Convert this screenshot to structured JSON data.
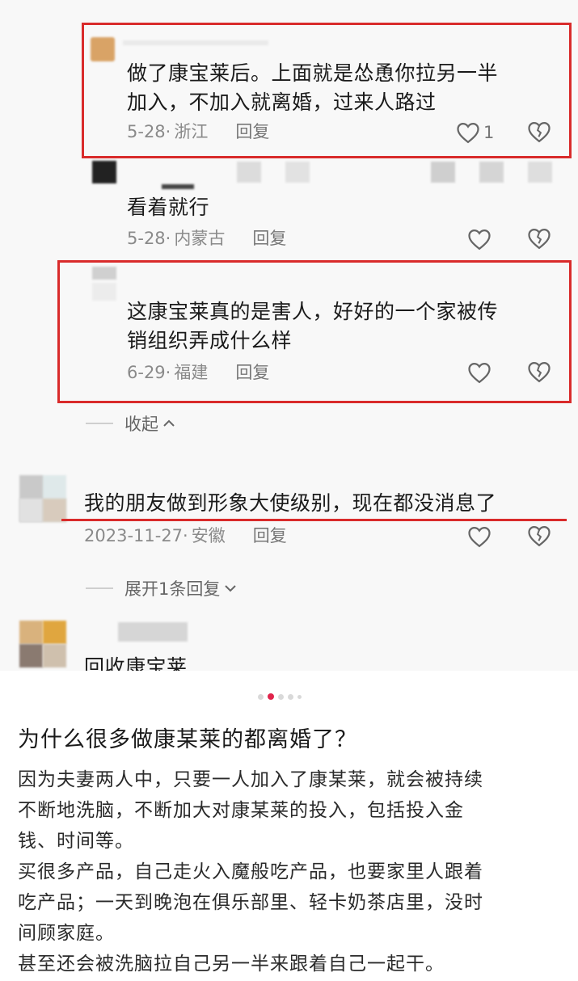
{
  "comments": [
    {
      "text_line1": "做了康宝莱后。上面就是怂恿你拉另一半",
      "text_line2": "加入，不加入就离婚，过来人路过",
      "date": "5-28",
      "location": "浙江",
      "reply": "回复",
      "likes": "1"
    },
    {
      "text_line1": "看着就行",
      "date": "5-28",
      "location": "内蒙古",
      "reply": "回复"
    },
    {
      "text_line1": "这康宝莱真的是害人，好好的一个家被传",
      "text_line2": "销组织弄成什么样",
      "date": "6-29",
      "location": "福建",
      "reply": "回复"
    },
    {
      "text_line1": "我的朋友做到形象大使级别，现在都没消息了",
      "date": "2023-11-27",
      "location": "安徽",
      "reply": "回复"
    },
    {
      "text_line1": "回收康宝莱"
    }
  ],
  "collapse_label": "收起",
  "expand_label": "展开1条回复",
  "date_sep": "·",
  "question_title": "为什么很多做康某莱的都离婚了？",
  "answer": [
    "因为夫妻两人中，只要一人加入了康某莱，就会被持续",
    "不断地洗脑，不断加大对康某莱的投入，包括投入金",
    "钱、时间等。",
    "买很多产品，自己走火入魔般吃产品，也要家里人跟着",
    "吃产品；一天到晚泡在俱乐部里、轻卡奶茶店里，没时",
    "间顾家庭。",
    "甚至还会被洗脑拉自己另一半来跟着自己一起干。"
  ],
  "carousel": {
    "count": 5,
    "active": 1
  },
  "colors": {
    "highlight": "#d92b2b",
    "dot_active": "#e0244b"
  },
  "icons": [
    "heart-icon",
    "broken-heart-icon",
    "chevron-up-icon",
    "chevron-down-icon"
  ]
}
